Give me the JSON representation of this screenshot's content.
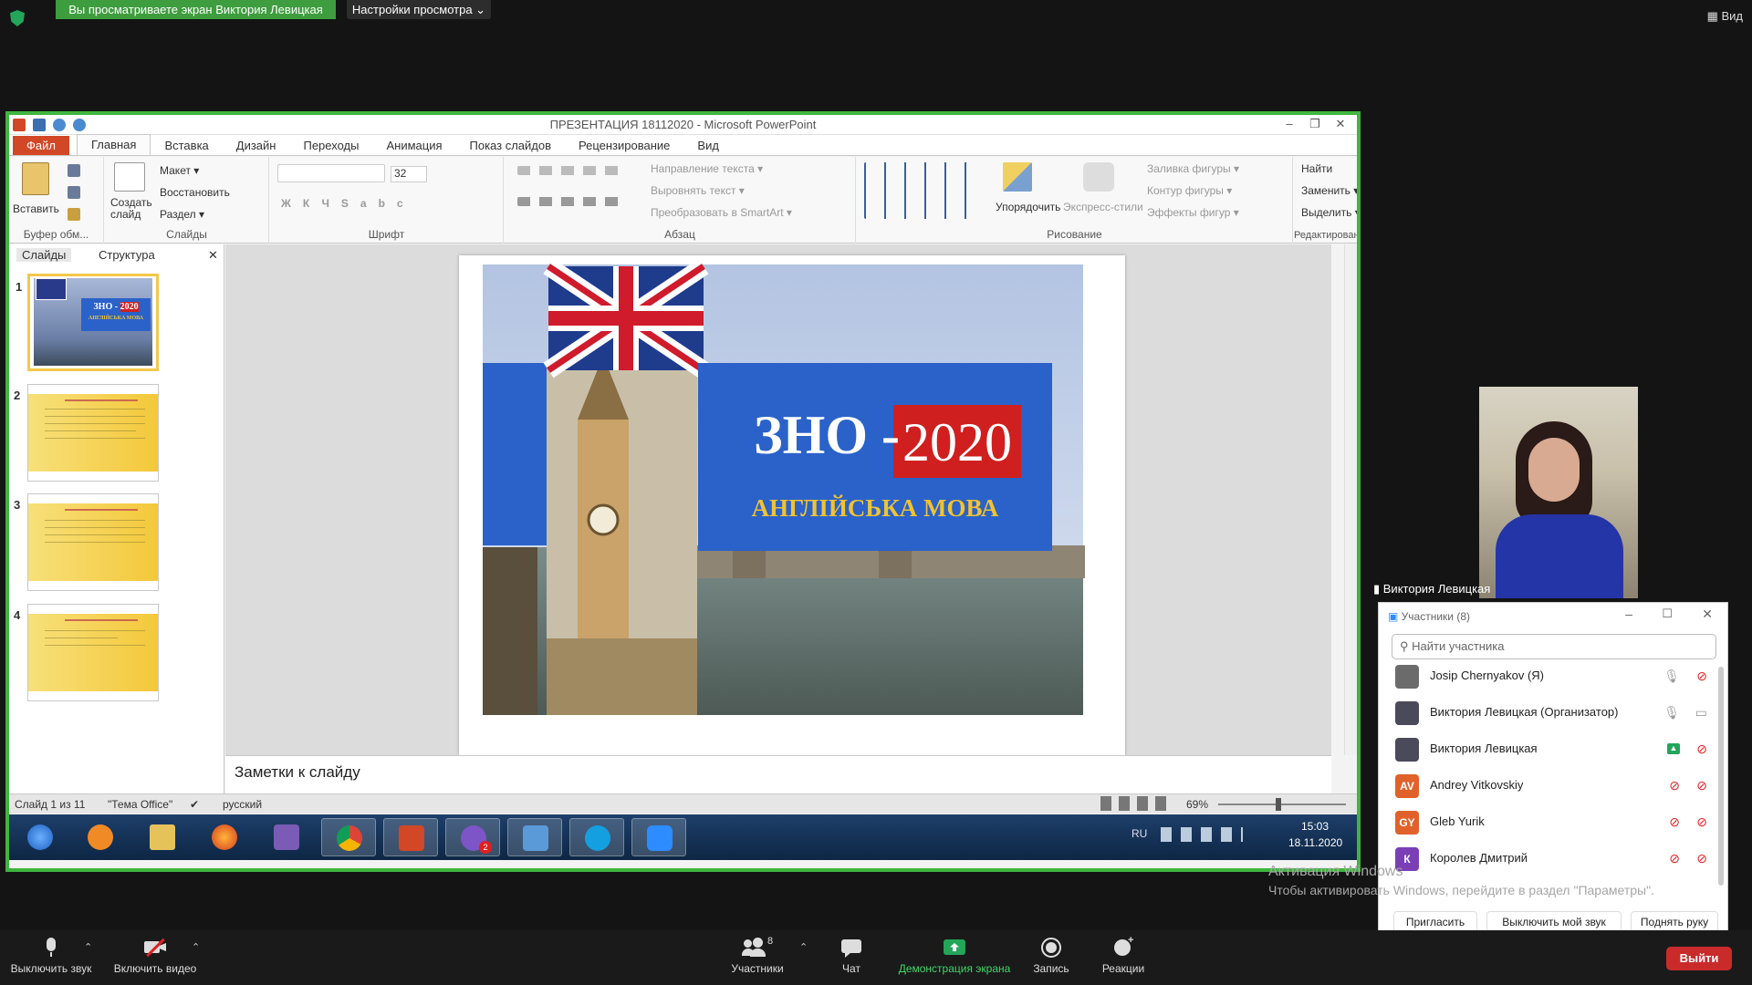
{
  "zoom_top": {
    "banner": "Вы просматриваете экран Виктория Левицкая",
    "view_options": "Настройки просмотра ⌄",
    "view_label": "Вид"
  },
  "ppt": {
    "title": "ПРЕЗЕНТАЦИЯ 18112020  -  Microsoft PowerPoint",
    "tabs": [
      "Файл",
      "Главная",
      "Вставка",
      "Дизайн",
      "Переходы",
      "Анимация",
      "Показ слайдов",
      "Рецензирование",
      "Вид"
    ],
    "ribbon": {
      "clipboard": {
        "paste": "Вставить",
        "label": "Буфер обм..."
      },
      "slides": {
        "create": "Создать слайд",
        "layout": "Макет ▾",
        "restore": "Восстановить",
        "section": "Раздел ▾",
        "label": "Слайды"
      },
      "font": {
        "size": "32",
        "label": "Шрифт"
      },
      "paragraph": {
        "direction": "Направление текста ▾",
        "align": "Выровнять текст ▾",
        "smartart": "Преобразовать в SmartArt ▾",
        "label": "Абзац"
      },
      "drawing": {
        "arrange": "Упорядочить",
        "express": "Экспресс-стили",
        "fill": "Заливка фигуры ▾",
        "outline": "Контур фигуры ▾",
        "effects": "Эффекты фигур ▾",
        "label": "Рисование"
      },
      "editing": {
        "find": "Найти",
        "replace": "Заменить ▾",
        "select": "Выделить ▾",
        "label": "Редактирование"
      }
    },
    "pane_tabs": [
      "Слайды",
      "Структура"
    ],
    "thumbnails": [
      "1",
      "2",
      "3",
      "4"
    ],
    "slide": {
      "title_left": "ЗНО - ",
      "title_year": "2020",
      "subtitle": "АНГЛІЙСЬКА МОВА",
      "thumb_title_left": "ЗНО - ",
      "thumb_title_year": "2020",
      "thumb_subtitle": "АНГЛІЙСЬКА МОВА"
    },
    "notes_placeholder": "Заметки к слайду",
    "status": {
      "slide": "Слайд 1 из 11",
      "theme": "\"Тема Office\"",
      "lang": "русский",
      "zoom": "69%"
    },
    "taskbar": {
      "lang": "RU",
      "time": "15:03",
      "date": "18.11.2020",
      "badge": "2"
    }
  },
  "zoom_right": {
    "video_name": "Виктория Левицкая",
    "participants_title": "Участники (8)",
    "search_placeholder": "Найти участника",
    "participants": [
      {
        "name": "Josip Chernyakov (Я)",
        "initials": "",
        "color": "#6b6b6b"
      },
      {
        "name": "Виктория Левицкая (Организатор)",
        "initials": "",
        "color": "#4a4a5a"
      },
      {
        "name": "Виктория Левицкая",
        "initials": "",
        "color": "#4a4a5a"
      },
      {
        "name": "Andrey Vitkovskiy",
        "initials": "AV",
        "color": "#e0622a"
      },
      {
        "name": "Gleb Yurik",
        "initials": "GY",
        "color": "#e0622a"
      },
      {
        "name": "Королев Дмитрий",
        "initials": "К",
        "color": "#7a3fb5"
      }
    ],
    "buttons": {
      "invite": "Пригласить",
      "mute_me": "Выключить мой звук",
      "raise": "Поднять руку"
    },
    "activation_line1": "Активация Windows",
    "activation_line2": "Чтобы активировать Windows, перейдите в раздел \"Параметры\"."
  },
  "bottom_bar": {
    "mute": "Выключить звук",
    "video": "Включить видео",
    "participants": "Участники",
    "participants_count": "8",
    "chat": "Чат",
    "share": "Демонстрация экрана",
    "record": "Запись",
    "reactions": "Реакции",
    "leave": "Выйти"
  },
  "colors": {
    "accent_green": "#3fb53f",
    "ppt_red": "#d24726",
    "slide_blue": "#2a62c9",
    "year_red": "#d01f1f",
    "gold": "#f1c232"
  }
}
